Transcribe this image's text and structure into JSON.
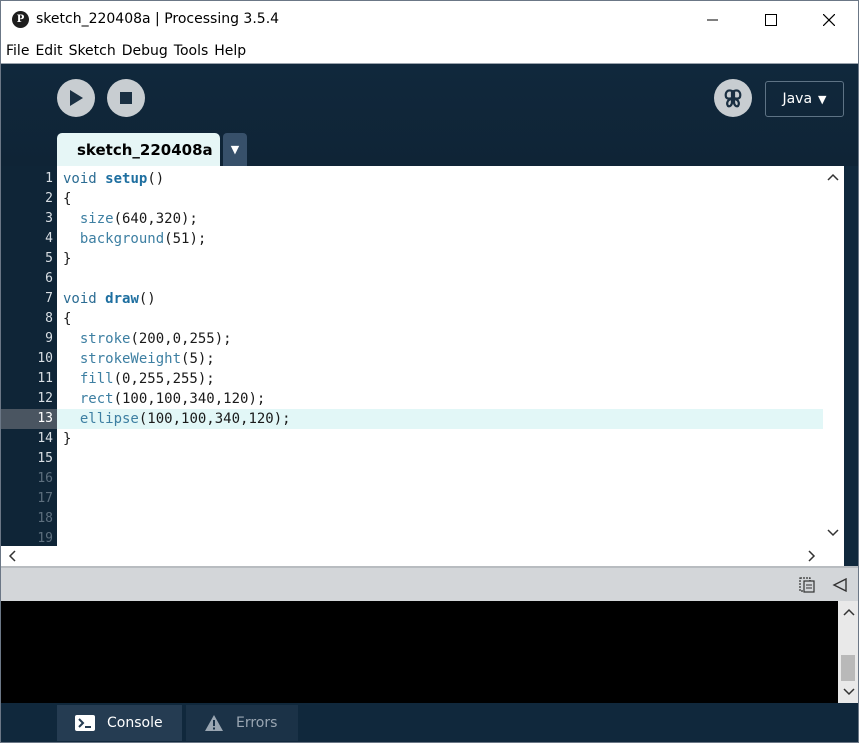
{
  "window": {
    "title": "sketch_220408a | Processing 3.5.4",
    "logo": "P"
  },
  "menu": [
    "File",
    "Edit",
    "Sketch",
    "Debug",
    "Tools",
    "Help"
  ],
  "toolbar": {
    "mode_label": "Java",
    "mode_arrow": "▼"
  },
  "tabs": {
    "active": "sketch_220408a",
    "menu_arrow": "▼"
  },
  "editor": {
    "current_line": 13,
    "line_numbers": [
      "1",
      "2",
      "3",
      "4",
      "5",
      "6",
      "7",
      "8",
      "9",
      "10",
      "11",
      "12",
      "13",
      "14",
      "15",
      "16",
      "17",
      "18",
      "19"
    ],
    "lines": [
      [
        {
          "t": "void ",
          "c": "kw"
        },
        {
          "t": "setup",
          "c": "fn"
        },
        {
          "t": "()",
          "c": ""
        }
      ],
      [
        {
          "t": "{",
          "c": ""
        }
      ],
      [
        {
          "t": "  ",
          "c": ""
        },
        {
          "t": "size",
          "c": "call"
        },
        {
          "t": "(640,320);",
          "c": ""
        }
      ],
      [
        {
          "t": "  ",
          "c": ""
        },
        {
          "t": "background",
          "c": "call"
        },
        {
          "t": "(51);",
          "c": ""
        }
      ],
      [
        {
          "t": "}",
          "c": ""
        }
      ],
      [],
      [
        {
          "t": "void ",
          "c": "kw"
        },
        {
          "t": "draw",
          "c": "fn"
        },
        {
          "t": "()",
          "c": ""
        }
      ],
      [
        {
          "t": "{",
          "c": ""
        }
      ],
      [
        {
          "t": "  ",
          "c": ""
        },
        {
          "t": "stroke",
          "c": "call"
        },
        {
          "t": "(200,0,255);",
          "c": ""
        }
      ],
      [
        {
          "t": "  ",
          "c": ""
        },
        {
          "t": "strokeWeight",
          "c": "call"
        },
        {
          "t": "(5);",
          "c": ""
        }
      ],
      [
        {
          "t": "  ",
          "c": ""
        },
        {
          "t": "fill",
          "c": "call"
        },
        {
          "t": "(0,255,255);",
          "c": ""
        }
      ],
      [
        {
          "t": "  ",
          "c": ""
        },
        {
          "t": "rect",
          "c": "call"
        },
        {
          "t": "(100,100,340,120);",
          "c": ""
        }
      ],
      [
        {
          "t": "  ",
          "c": ""
        },
        {
          "t": "ellipse",
          "c": "call"
        },
        {
          "t": "(100,100,340,120);",
          "c": ""
        }
      ],
      [
        {
          "t": "}",
          "c": ""
        }
      ],
      [],
      [],
      [],
      [],
      []
    ]
  },
  "console_tabs": {
    "console_label": "Console",
    "errors_label": "Errors"
  },
  "icons": {
    "run": "play-icon",
    "stop": "stop-icon",
    "debug": "butterfly-debug-icon",
    "copy": "clipboard-icon",
    "collapse": "triangle-left-icon",
    "console": "terminal-icon",
    "errors": "warning-icon"
  },
  "colors": {
    "toolbar_bg": "#10283c",
    "tab_active_bg": "#e6f6f6",
    "current_line_bg": "#e2f7f7",
    "keyword": "#2b6c93"
  }
}
